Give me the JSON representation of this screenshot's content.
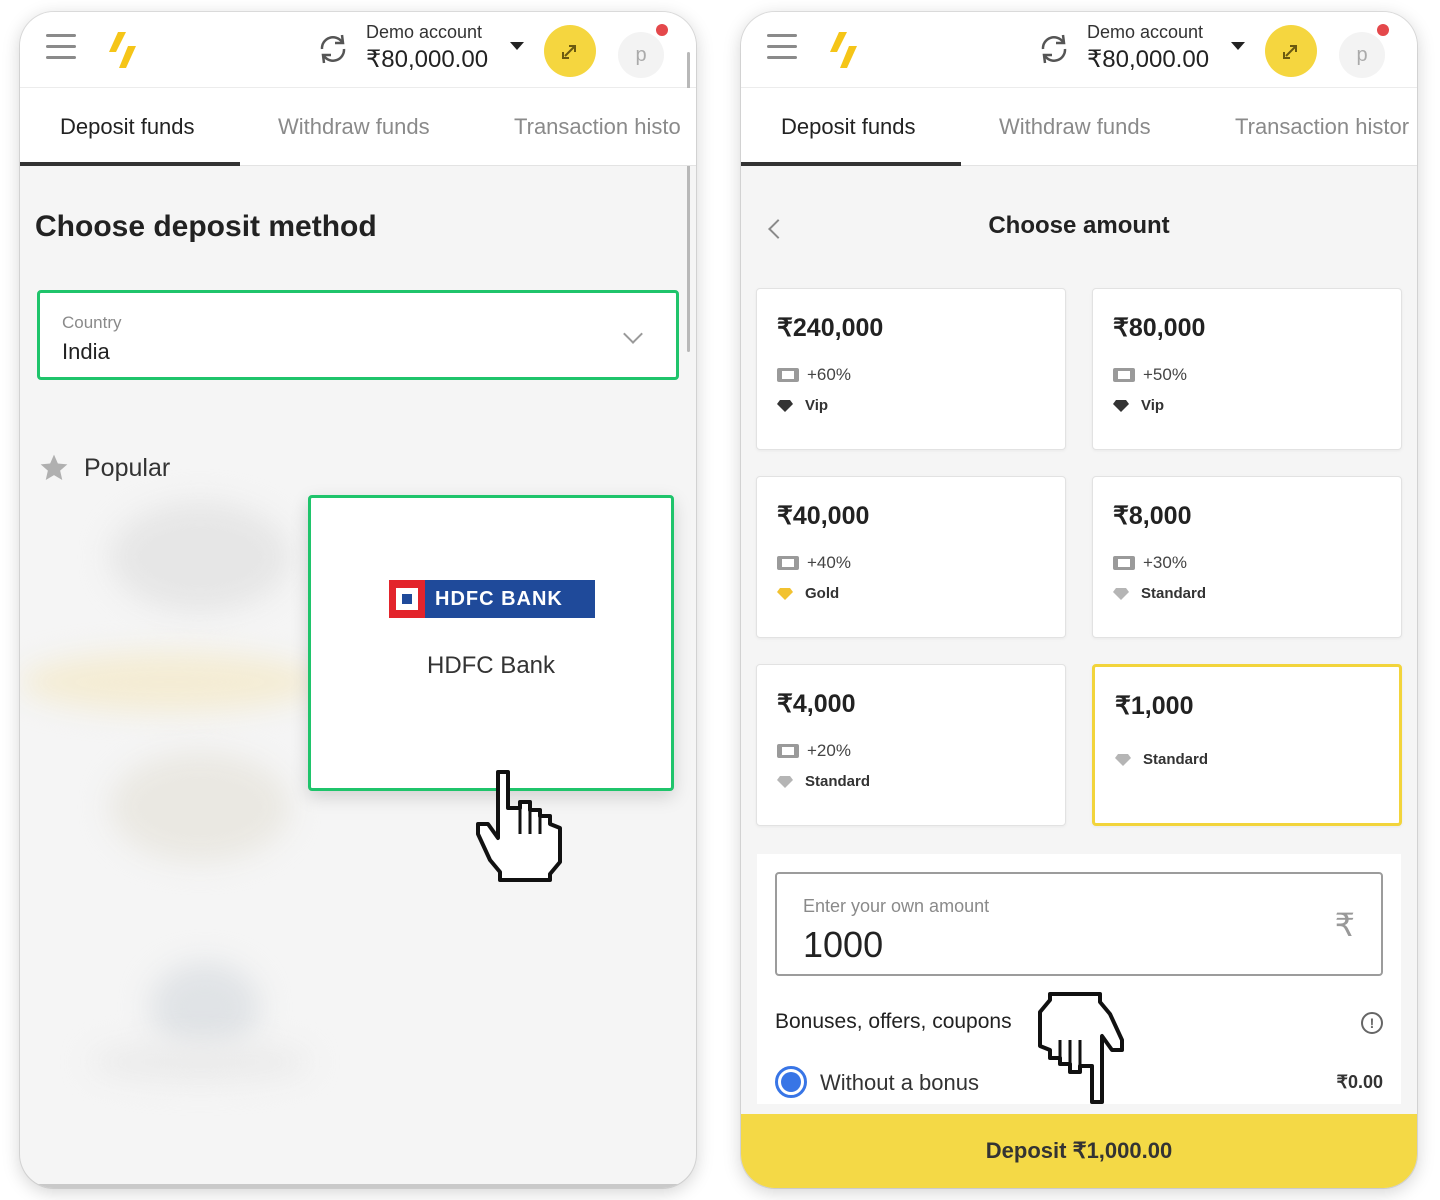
{
  "left": {
    "header": {
      "account_label": "Demo account",
      "balance": "₹80,000.00",
      "avatar_letter": "p"
    },
    "tabs": [
      "Deposit funds",
      "Withdraw funds",
      "Transaction histo"
    ],
    "title": "Choose deposit method",
    "country": {
      "label": "Country",
      "value": "India"
    },
    "popular_label": "Popular",
    "method": {
      "logo_text": "HDFC BANK",
      "name": "HDFC Bank"
    }
  },
  "right": {
    "header": {
      "account_label": "Demo account",
      "balance": "₹80,000.00",
      "avatar_letter": "p"
    },
    "tabs": [
      "Deposit funds",
      "Withdraw funds",
      "Transaction histor"
    ],
    "title": "Choose amount",
    "amounts": [
      {
        "value": "₹240,000",
        "bonus": "+60%",
        "tier": "Vip"
      },
      {
        "value": "₹80,000",
        "bonus": "+50%",
        "tier": "Vip"
      },
      {
        "value": "₹40,000",
        "bonus": "+40%",
        "tier": "Gold"
      },
      {
        "value": "₹8,000",
        "bonus": "+30%",
        "tier": "Standard"
      },
      {
        "value": "₹4,000",
        "bonus": "+20%",
        "tier": "Standard"
      },
      {
        "value": "₹1,000",
        "tier": "Standard",
        "selected": true
      }
    ],
    "own_amount": {
      "label": "Enter your own amount",
      "value": "1000",
      "currency_symbol": "₹"
    },
    "bonuses": {
      "title": "Bonuses, offers, coupons",
      "option_label": "Without a bonus",
      "option_value": "₹0.00"
    },
    "deposit_button": "Deposit ₹1,000.00"
  },
  "colors": {
    "accent_green": "#1fc46b",
    "accent_yellow": "#f4d946",
    "radio_blue": "#3875e6",
    "notification_red": "#e4484b"
  }
}
